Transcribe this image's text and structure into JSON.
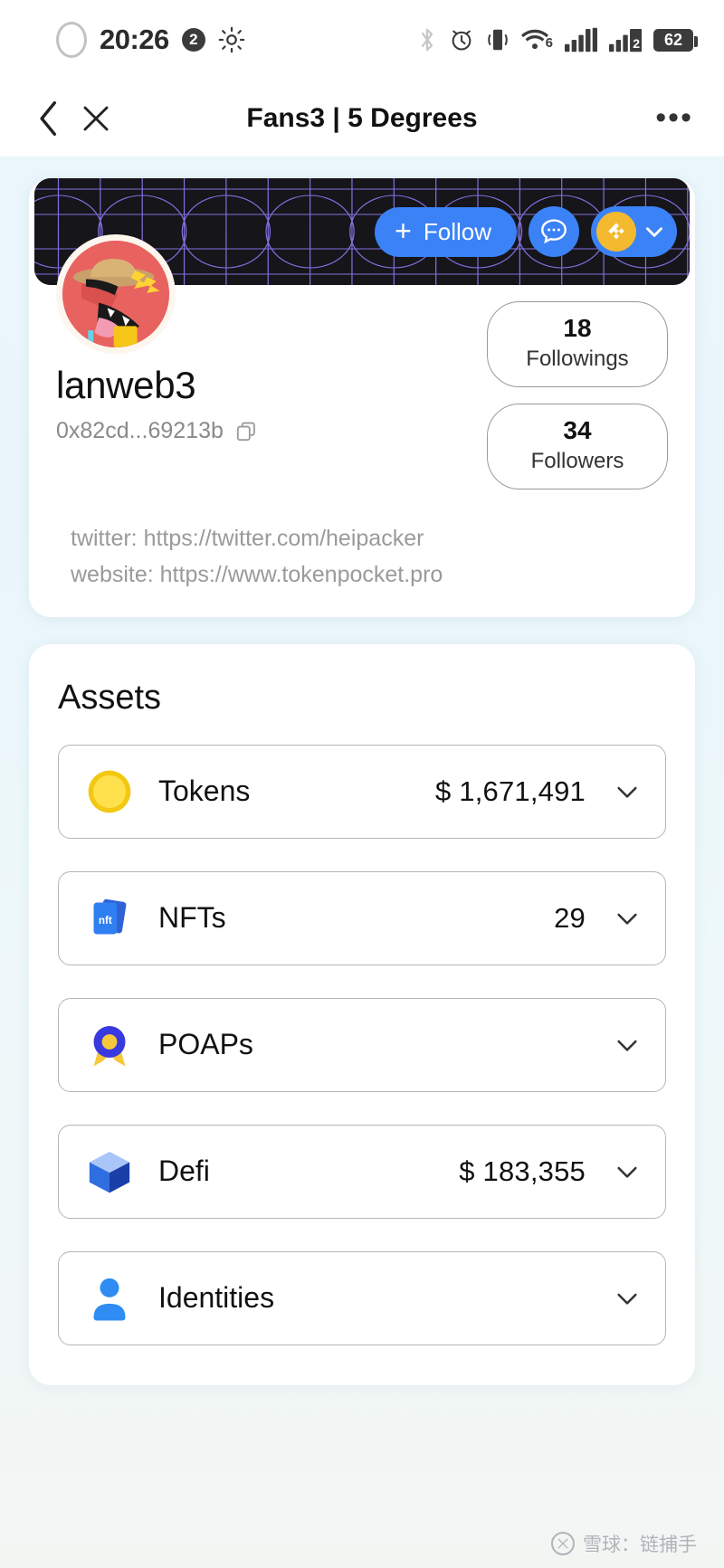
{
  "status_bar": {
    "time": "20:26",
    "notification_count": "2",
    "wifi_gen": "6",
    "sim2_label": "2",
    "battery": "62",
    "icons": [
      "camera-ring-icon",
      "brightness-icon",
      "bluetooth-icon",
      "alarm-icon",
      "vibrate-icon",
      "wifi-icon",
      "signal-icon",
      "signal-2-icon",
      "battery-icon"
    ]
  },
  "nav": {
    "title": "Fans3 | 5 Degrees",
    "back_icon": "chevron-left-icon",
    "close_icon": "close-icon",
    "more_icon": "more-horizontal-icon"
  },
  "profile": {
    "username": "lanweb3",
    "address": "0x82cd...69213b",
    "follow_label": "Follow",
    "message_icon": "chat-bubble-icon",
    "chain_icon": "bnb-chain-icon",
    "chain_dropdown_icon": "chevron-down-icon",
    "copy_icon": "copy-icon",
    "avatar_icon": "user-avatar",
    "stats": [
      {
        "value": "18",
        "label": "Followings"
      },
      {
        "value": "34",
        "label": "Followers"
      }
    ],
    "links": [
      "twitter: https://twitter.com/heipacker",
      "website: https://www.tokenpocket.pro"
    ]
  },
  "assets": {
    "title": "Assets",
    "rows": [
      {
        "icon": "coin-icon",
        "label": "Tokens",
        "value": "$ 1,671,491",
        "chevron": "chevron-down-icon"
      },
      {
        "icon": "nft-cards-icon",
        "label": "NFTs",
        "value": "29",
        "chevron": "chevron-down-icon"
      },
      {
        "icon": "poap-badge-icon",
        "label": "POAPs",
        "value": "",
        "chevron": "chevron-down-icon"
      },
      {
        "icon": "cube-icon",
        "label": "Defi",
        "value": "$ 183,355",
        "chevron": "chevron-down-icon"
      },
      {
        "icon": "person-icon",
        "label": "Identities",
        "value": "",
        "chevron": "chevron-down-icon"
      }
    ]
  },
  "watermark": {
    "text": "雪球：链捕手",
    "logo_icon": "xueqiu-logo-icon"
  },
  "colors": {
    "accent_blue": "#3b82f6",
    "bnb_yellow": "#f3ba2f",
    "banner_dark": "#15151a",
    "banner_grid": "#8b74e8",
    "page_bg": "#eaf6fb",
    "muted_text": "#9a9a9a"
  }
}
